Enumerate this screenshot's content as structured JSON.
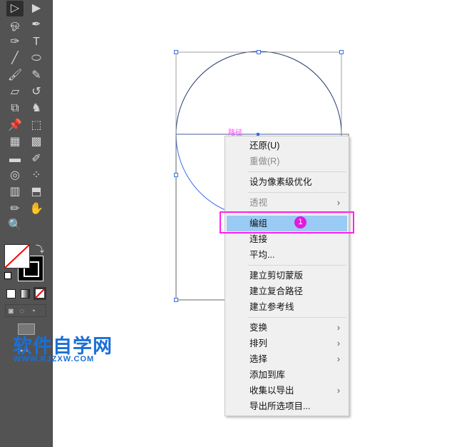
{
  "toolbar": {
    "tools": [
      "selection",
      "direct-selection",
      "lasso",
      "pen",
      "curvature",
      "type",
      "line",
      "ellipse",
      "paintbrush",
      "shaper",
      "eraser",
      "rotate",
      "scale",
      "puppet-warp",
      "pin",
      "free-transform",
      "perspective-grid",
      "mesh",
      "gradient",
      "eyedropper",
      "blend",
      "symbol-sprayer",
      "column-graph",
      "artboard",
      "pencil",
      "hand",
      "zoom"
    ]
  },
  "canvas": {
    "path_label": "路径",
    "selection_color": "#3a6df0"
  },
  "context_menu": {
    "items": [
      {
        "label": "还原(U)",
        "enabled": true
      },
      {
        "label": "重做(R)",
        "enabled": false
      },
      {
        "label": "设为像素级优化",
        "enabled": true
      },
      {
        "label": "透视",
        "enabled": false,
        "submenu": true
      },
      {
        "label": "编组",
        "enabled": true,
        "highlighted": true
      },
      {
        "label": "连接",
        "enabled": true
      },
      {
        "label": "平均...",
        "enabled": true
      },
      {
        "label": "建立剪切蒙版",
        "enabled": true
      },
      {
        "label": "建立复合路径",
        "enabled": true
      },
      {
        "label": "建立参考线",
        "enabled": true
      },
      {
        "label": "变换",
        "enabled": true,
        "submenu": true
      },
      {
        "label": "排列",
        "enabled": true,
        "submenu": true
      },
      {
        "label": "选择",
        "enabled": true,
        "submenu": true
      },
      {
        "label": "添加到库",
        "enabled": true
      },
      {
        "label": "收集以导出",
        "enabled": true,
        "submenu": true
      },
      {
        "label": "导出所选项目...",
        "enabled": true
      }
    ],
    "submenu_arrow": "›"
  },
  "annotation": {
    "step": "1",
    "color": "#ff1ff0"
  },
  "watermark": {
    "title": "软件自学网",
    "url": "WWW.RJZXW.COM"
  }
}
